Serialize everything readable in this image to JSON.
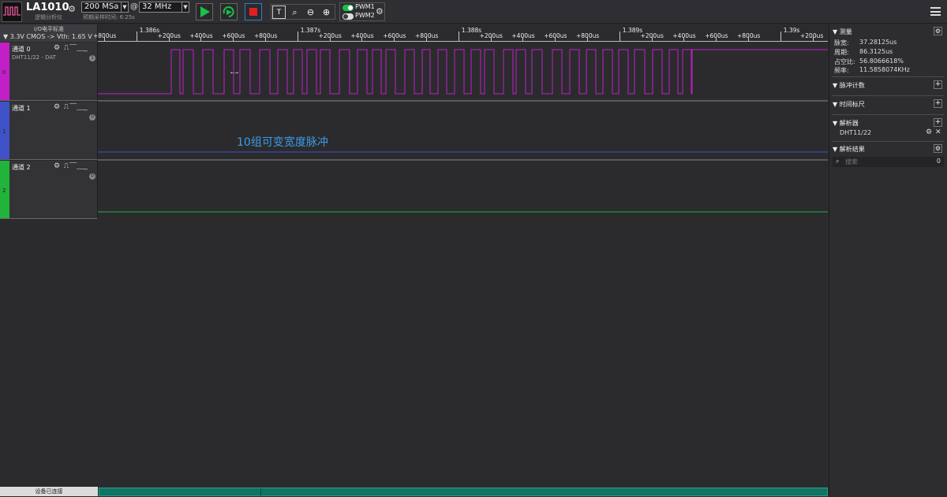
{
  "app": {
    "model": "LA1010",
    "subtitle": "逻辑分析仪",
    "sample_rate": "200 MSa",
    "at": "@",
    "depth": "32 MHz",
    "est_time": "预期采样时间: 6.25s"
  },
  "pwm": {
    "pwm1": "PWM1",
    "pwm2": "PWM2",
    "pwm1_on": true,
    "pwm2_on": false
  },
  "io": {
    "standard": "I/O电平标准",
    "voltage": "▼  3.3V CMOS  -> Vth: 1.65 V"
  },
  "channels": [
    {
      "index": "0",
      "name": "通道 0",
      "sub": "DHT11/22 - DAT",
      "count": "1",
      "color": "#c21fc9"
    },
    {
      "index": "1",
      "name": "通道 1",
      "sub": "",
      "count": "0",
      "color": "#4052c8"
    },
    {
      "index": "2",
      "name": "通道 2",
      "sub": "",
      "count": "0",
      "color": "#22b33a"
    }
  ],
  "timeline": {
    "ticks": [
      {
        "label": "+800us",
        "major": false
      },
      {
        "label": "1.386s",
        "major": true
      },
      {
        "label": "+200us",
        "major": false
      },
      {
        "label": "+400us",
        "major": false
      },
      {
        "label": "+600us",
        "major": false
      },
      {
        "label": "+800us",
        "major": false
      },
      {
        "label": "1.387s",
        "major": true
      },
      {
        "label": "+200us",
        "major": false
      },
      {
        "label": "+400us",
        "major": false
      },
      {
        "label": "+600us",
        "major": false
      },
      {
        "label": "+800us",
        "major": false
      },
      {
        "label": "1.388s",
        "major": true
      },
      {
        "label": "+200us",
        "major": false
      },
      {
        "label": "+400us",
        "major": false
      },
      {
        "label": "+600us",
        "major": false
      },
      {
        "label": "+800us",
        "major": false
      },
      {
        "label": "1.389s",
        "major": true
      },
      {
        "label": "+200us",
        "major": false
      },
      {
        "label": "+400us",
        "major": false
      },
      {
        "label": "+600us",
        "major": false
      },
      {
        "label": "+800us",
        "major": false
      },
      {
        "label": "1.39s",
        "major": true
      },
      {
        "label": "+200us",
        "major": false
      }
    ]
  },
  "annotation": "10组可变宽度脉冲",
  "measure": {
    "title": "测量",
    "pulse_width_label": "脉宽:",
    "pulse_width": "37.28125us",
    "period_label": "周期:",
    "period": "86.3125us",
    "duty_label": "占空比:",
    "duty": "56.8066618%",
    "freq_label": "频率:",
    "freq": "11.5858074KHz"
  },
  "sections": {
    "pulse_count": "脉冲计数",
    "time_ruler": "时间标尺",
    "analyzer": "解析器",
    "analyzer_item": "DHT11/22",
    "results": "解析结果",
    "search_placeholder": "搜索",
    "search_count": "0"
  },
  "status": {
    "text": "设备已连接"
  },
  "icons": {
    "settings": "gear-icon",
    "run": "play-icon",
    "loop": "loop-play-icon",
    "stop": "stop-icon",
    "text_tool": "text-tool-icon",
    "zoom_fit": "zoom-fit-icon",
    "zoom_out": "zoom-out-icon",
    "zoom_in": "zoom-in-icon",
    "menu": "hamburger-menu-icon",
    "search": "search-icon",
    "add": "plus-icon",
    "remove": "close-icon"
  }
}
